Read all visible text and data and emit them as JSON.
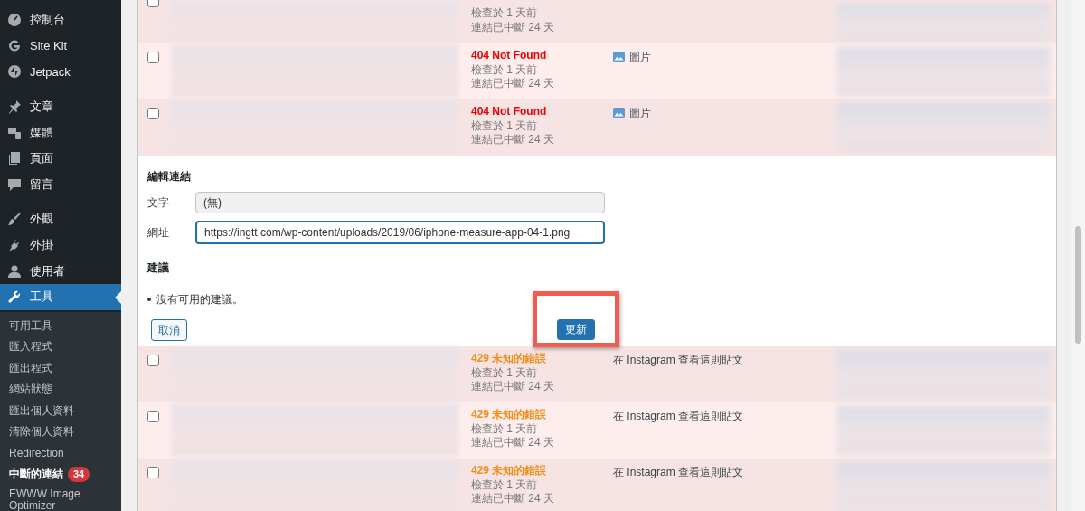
{
  "sidebar": {
    "groups": [
      [
        {
          "label": "控制台",
          "selected": false
        },
        {
          "label": "Site Kit",
          "selected": false
        },
        {
          "label": "Jetpack",
          "selected": false
        }
      ],
      [
        {
          "label": "文章",
          "selected": false
        },
        {
          "label": "媒體",
          "selected": false
        },
        {
          "label": "頁面",
          "selected": false
        },
        {
          "label": "留言",
          "selected": false
        }
      ],
      [
        {
          "label": "外觀",
          "selected": false
        },
        {
          "label": "外掛",
          "selected": false
        },
        {
          "label": "使用者",
          "selected": false
        },
        {
          "label": "工具",
          "selected": true
        }
      ]
    ],
    "submenu": [
      {
        "label": "可用工具",
        "selected": false
      },
      {
        "label": "匯入程式",
        "selected": false
      },
      {
        "label": "匯出程式",
        "selected": false
      },
      {
        "label": "網站狀態",
        "selected": false
      },
      {
        "label": "匯出個人資料",
        "selected": false
      },
      {
        "label": "清除個人資料",
        "selected": false
      },
      {
        "label": "Redirection",
        "selected": false
      },
      {
        "label": "中斷的連結",
        "selected": true,
        "badge": "34"
      },
      {
        "label": "EWWW Image Optimizer",
        "selected": false
      }
    ]
  },
  "rows_above": [
    {
      "checked": false,
      "checked_text": "檢查於 1 天前",
      "broken_text": "連結已中斷 24 天"
    },
    {
      "checked": false,
      "kind": "not_found",
      "status": "404 Not Found",
      "checked_text": "檢查於 1 天前",
      "broken_text": "連結已中斷 24 天",
      "link": {
        "kind": "image",
        "text": "圖片"
      }
    },
    {
      "checked": false,
      "kind": "not_found",
      "status": "404 Not Found",
      "checked_text": "檢查於 1 天前",
      "broken_text": "連結已中斷 24 天",
      "link": {
        "kind": "image",
        "text": "圖片"
      }
    }
  ],
  "edit_panel": {
    "title": "編輯連結",
    "text_label": "文字",
    "text_value": "(無)",
    "url_label": "網址",
    "url_value": "https://ingtt.com/wp-content/uploads/2019/06/iphone-measure-app-04-1.png",
    "suggestions_title": "建議",
    "suggestions": [
      "沒有可用的建議。"
    ],
    "cancel": "取消",
    "update": "更新"
  },
  "rows_below": [
    {
      "checked": false,
      "kind": "unknown_error",
      "status": "429 未知的錯誤",
      "checked_text": "檢查於 1 天前",
      "broken_text": "連結已中斷 24 天",
      "link": {
        "kind": "text",
        "text": "在 Instagram 查看這則貼文"
      }
    },
    {
      "checked": false,
      "kind": "unknown_error",
      "status": "429 未知的錯誤",
      "checked_text": "檢查於 1 天前",
      "broken_text": "連結已中斷 24 天",
      "link": {
        "kind": "text",
        "text": "在 Instagram 查看這則貼文"
      }
    },
    {
      "checked": false,
      "kind": "unknown_error",
      "status": "429 未知的錯誤",
      "checked_text": "檢查於 1 天前",
      "broken_text": "連結已中斷 24 天",
      "link": {
        "kind": "text",
        "text": "在 Instagram 查看這則貼文"
      }
    }
  ]
}
